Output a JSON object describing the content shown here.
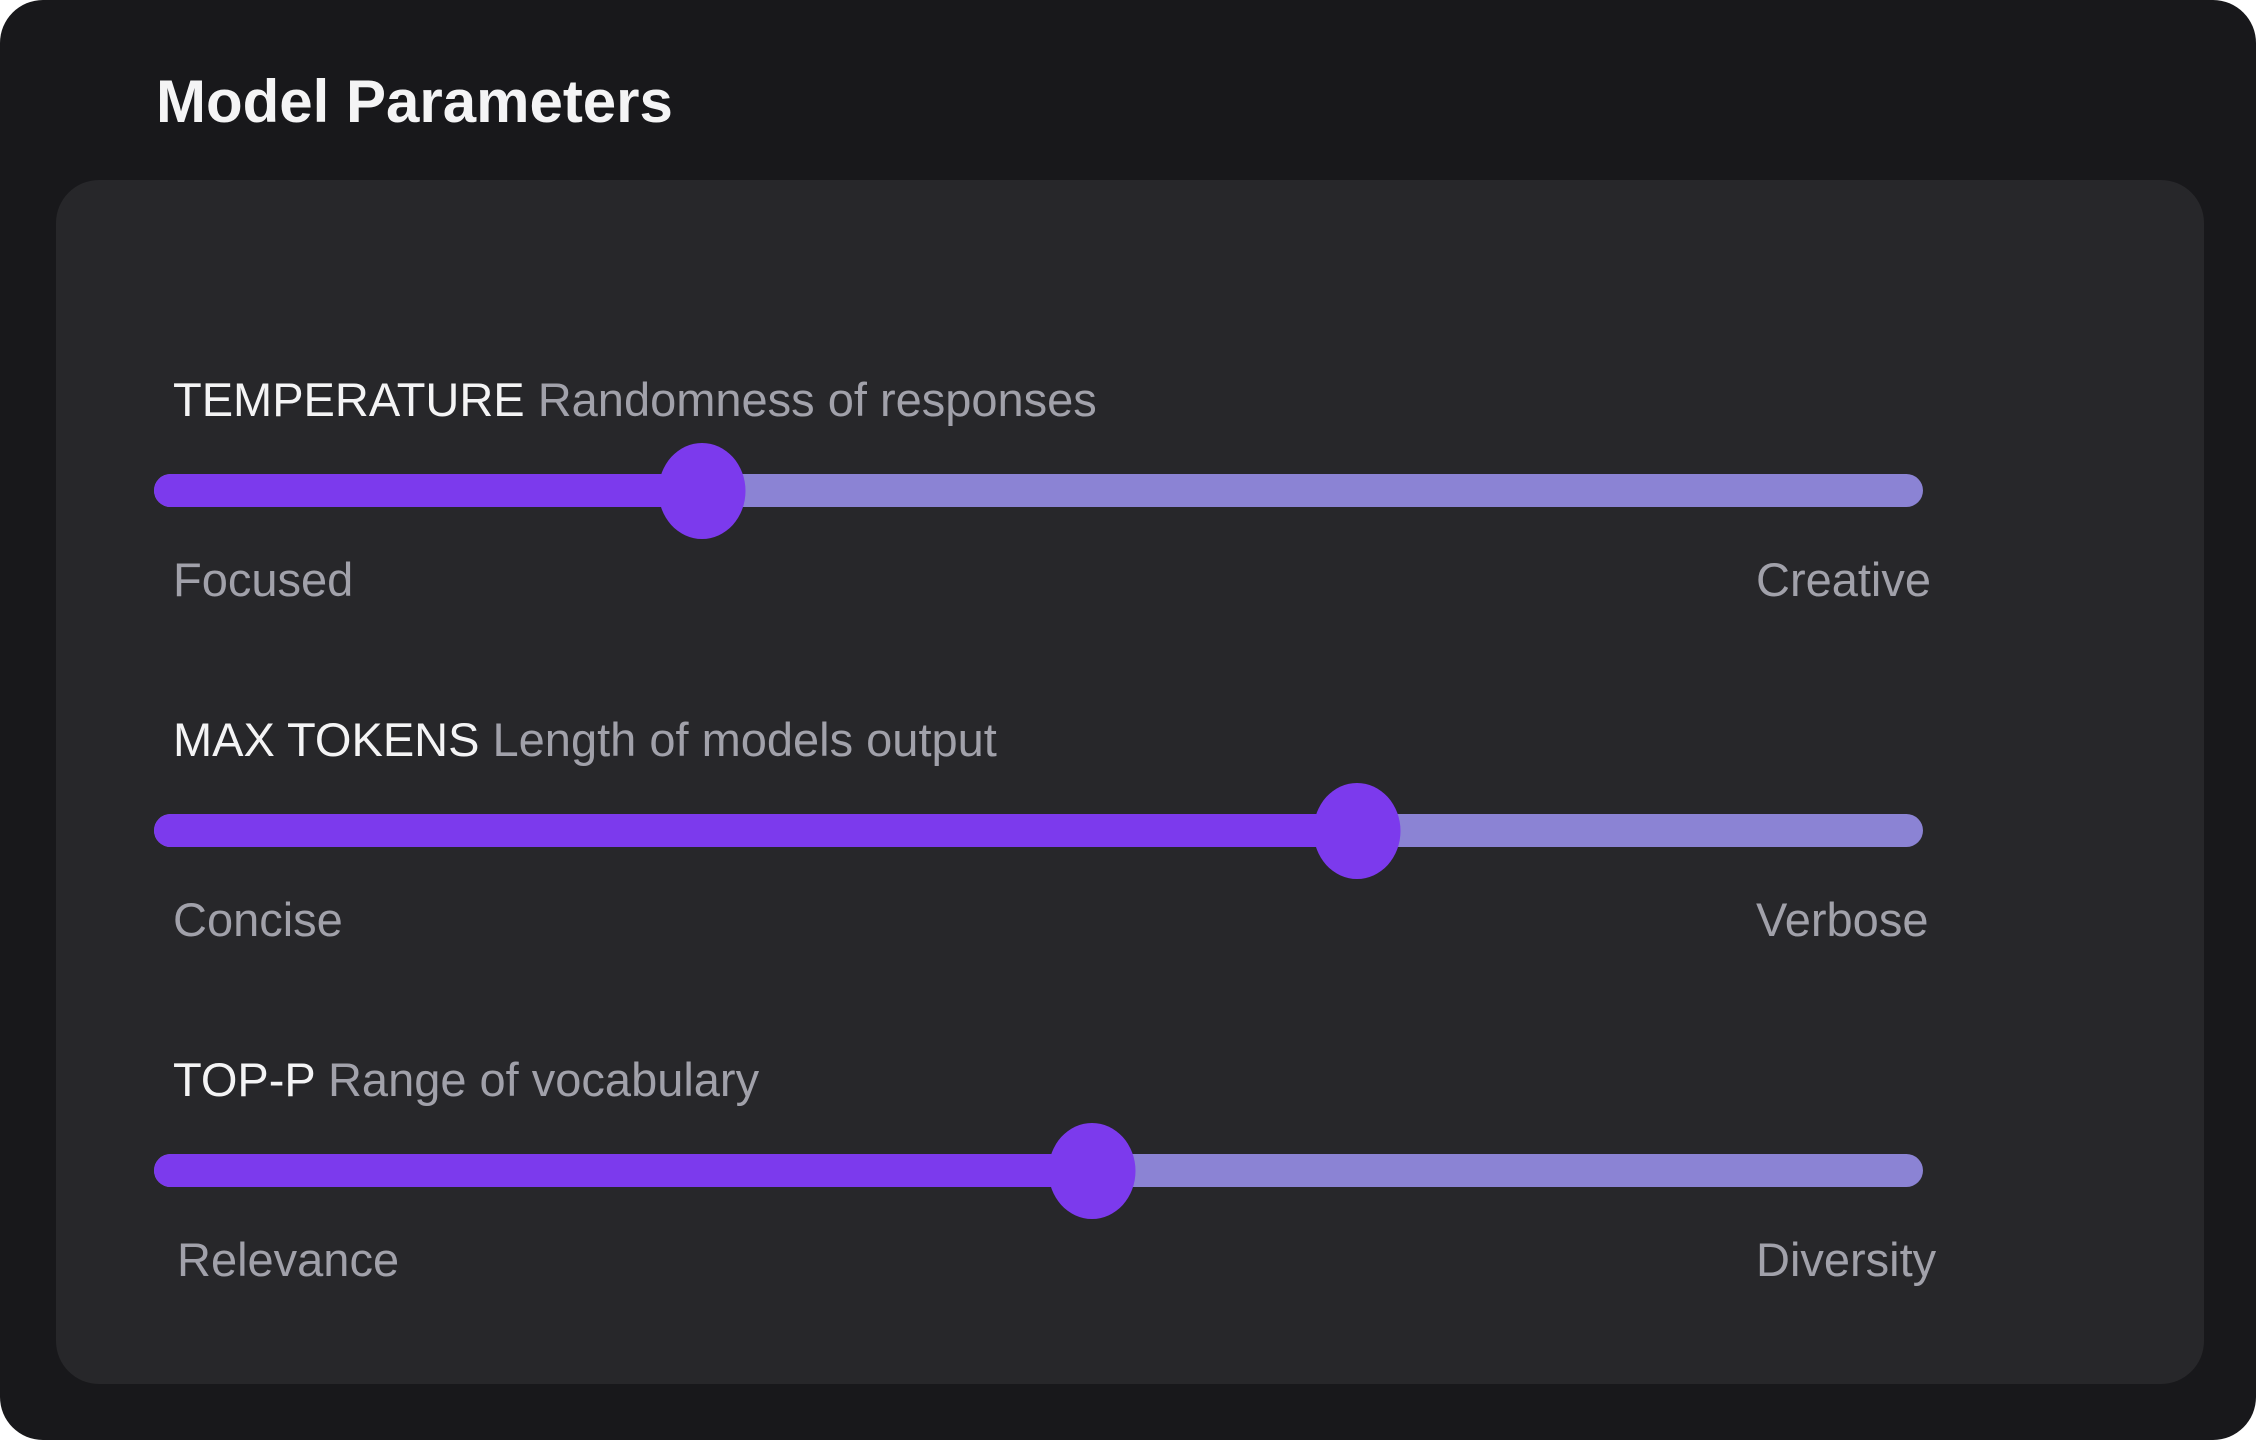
{
  "window": {
    "title": "Model Parameters"
  },
  "colors": {
    "background": "#18181b",
    "panel": "#27272a",
    "accent": "#7c3aed",
    "track": "#8b83d4",
    "text_primary": "#f4f4f5",
    "text_secondary": "#a1a1aa"
  },
  "parameters": [
    {
      "name": "TEMPERATURE",
      "description": "Randomness of responses",
      "min_label": "Focused",
      "max_label": "Creative",
      "value_fraction": 0.31
    },
    {
      "name": "MAX TOKENS",
      "description": "Length of models output",
      "min_label": "Concise",
      "max_label": "Verbose",
      "value_fraction": 0.68
    },
    {
      "name": "TOP-P",
      "description": "Range of vocabulary",
      "min_label": "Relevance",
      "max_label": "Diversity",
      "value_fraction": 0.53
    }
  ]
}
